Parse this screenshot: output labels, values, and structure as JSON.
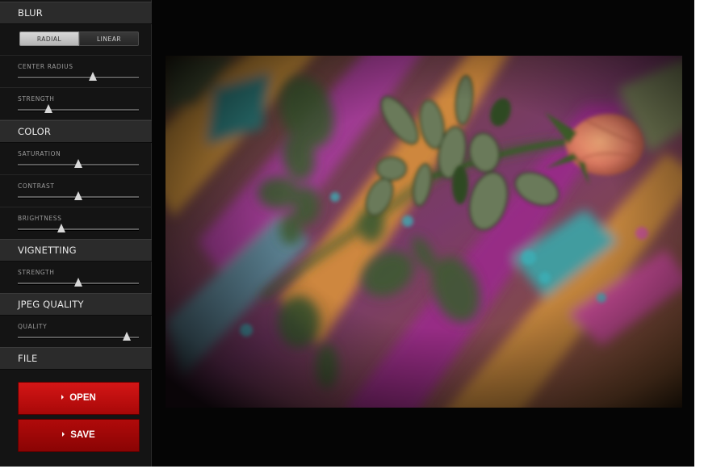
{
  "sidebar": {
    "blur": {
      "header": "BLUR",
      "toggle": {
        "radial": "RADIAL",
        "linear": "LINEAR",
        "selected": "RADIAL"
      },
      "center_radius": {
        "label": "CENTER RADIUS",
        "value": 0.62
      },
      "strength": {
        "label": "STRENGTH",
        "value": 0.25
      }
    },
    "color": {
      "header": "COLOR",
      "saturation": {
        "label": "SATURATION",
        "value": 0.5
      },
      "contrast": {
        "label": "CONTRAST",
        "value": 0.5
      },
      "brightness": {
        "label": "BRIGHTNESS",
        "value": 0.36
      }
    },
    "vignetting": {
      "header": "VIGNETTING",
      "strength": {
        "label": "STRENGTH",
        "value": 0.5
      }
    },
    "jpeg_quality": {
      "header": "JPEG QUALITY",
      "quality": {
        "label": "QUALITY",
        "value": 0.9
      }
    },
    "file": {
      "header": "FILE",
      "open_label": "OPEN",
      "save_label": "SAVE"
    }
  },
  "colors": {
    "accent_red": "#c80f0f",
    "panel": "#141414",
    "header": "#2b2b2b",
    "canvas": "#050505"
  },
  "icons": {
    "slider_thumb": "triangle-thumb-icon",
    "button_arrow": "caret-right-icon"
  }
}
